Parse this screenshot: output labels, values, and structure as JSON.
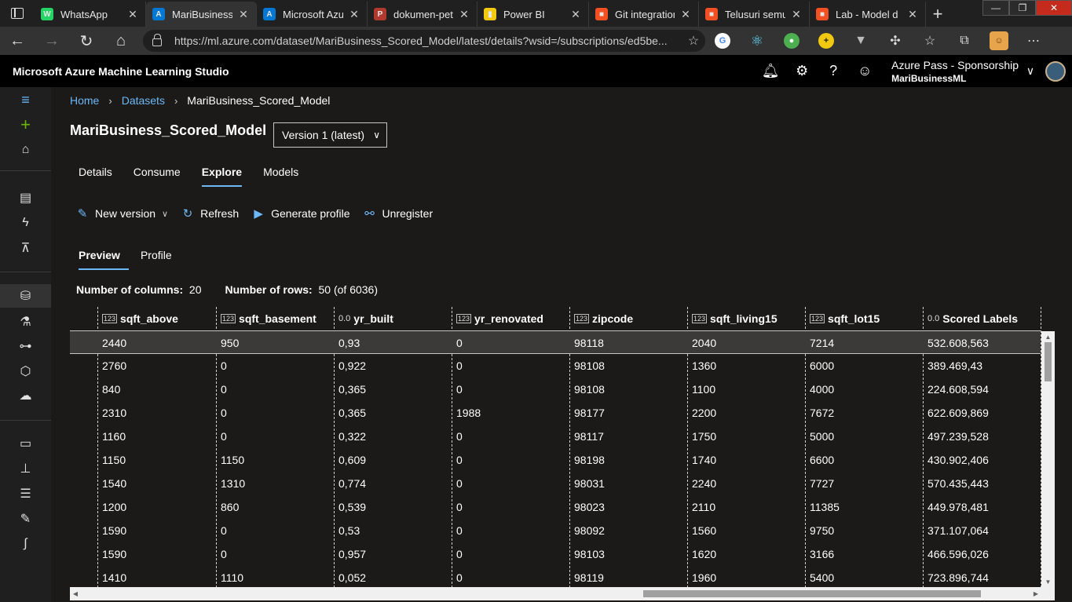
{
  "browser": {
    "tabs": [
      {
        "title": "WhatsApp",
        "fav_color": "#25d366",
        "fav_glyph": "W"
      },
      {
        "title": "MariBusiness_S",
        "fav_color": "#0078d4",
        "fav_glyph": "A"
      },
      {
        "title": "Microsoft Azu",
        "fav_color": "#0078d4",
        "fav_glyph": "A"
      },
      {
        "title": "dokumen-pet",
        "fav_color": "#b03a2e",
        "fav_glyph": "P"
      },
      {
        "title": "Power BI",
        "fav_color": "#f2c811",
        "fav_glyph": "▮"
      },
      {
        "title": "Git integration",
        "fav_color": "#f25022",
        "fav_glyph": "■"
      },
      {
        "title": "Telusuri semua",
        "fav_color": "#f25022",
        "fav_glyph": "■"
      },
      {
        "title": "Lab - Model d",
        "fav_color": "#f25022",
        "fav_glyph": "■"
      }
    ],
    "url": "https://ml.azure.com/dataset/MariBusiness_Scored_Model/latest/details?wsid=/subscriptions/ed5be..."
  },
  "app": {
    "brand": "Microsoft Azure Machine Learning Studio",
    "subscription": "Azure Pass - Sponsorship",
    "workspace": "MariBusinessML"
  },
  "breadcrumb": {
    "home": "Home",
    "datasets": "Datasets",
    "current": "MariBusiness_Scored_Model"
  },
  "page": {
    "title": "MariBusiness_Scored_Model",
    "version": "Version 1 (latest)"
  },
  "tabs": {
    "details": "Details",
    "consume": "Consume",
    "explore": "Explore",
    "models": "Models"
  },
  "toolbar": {
    "new_version": "New version",
    "refresh": "Refresh",
    "generate_profile": "Generate profile",
    "unregister": "Unregister"
  },
  "subtabs": {
    "preview": "Preview",
    "profile": "Profile"
  },
  "counts": {
    "columns_label": "Number of columns:",
    "columns_value": "20",
    "rows_label": "Number of rows:",
    "rows_value": "50 (of 6036)"
  },
  "grid": {
    "columns": [
      {
        "name": "sqft_above",
        "type": "123"
      },
      {
        "name": "sqft_basement",
        "type": "123"
      },
      {
        "name": "yr_built",
        "type": "0.0"
      },
      {
        "name": "yr_renovated",
        "type": "123"
      },
      {
        "name": "zipcode",
        "type": "123"
      },
      {
        "name": "sqft_living15",
        "type": "123"
      },
      {
        "name": "sqft_lot15",
        "type": "123"
      },
      {
        "name": "Scored Labels",
        "type": "0.0"
      }
    ],
    "rows": [
      [
        "2440",
        "950",
        "0,93",
        "0",
        "98118",
        "2040",
        "7214",
        "532.608,563"
      ],
      [
        "2760",
        "0",
        "0,922",
        "0",
        "98108",
        "1360",
        "6000",
        "389.469,43"
      ],
      [
        "840",
        "0",
        "0,365",
        "0",
        "98108",
        "1100",
        "4000",
        "224.608,594"
      ],
      [
        "2310",
        "0",
        "0,365",
        "1988",
        "98177",
        "2200",
        "7672",
        "622.609,869"
      ],
      [
        "1160",
        "0",
        "0,322",
        "0",
        "98117",
        "1750",
        "5000",
        "497.239,528"
      ],
      [
        "1150",
        "1150",
        "0,609",
        "0",
        "98198",
        "1740",
        "6600",
        "430.902,406"
      ],
      [
        "1540",
        "1310",
        "0,774",
        "0",
        "98031",
        "2240",
        "7727",
        "570.435,443"
      ],
      [
        "1200",
        "860",
        "0,539",
        "0",
        "98023",
        "2110",
        "11385",
        "449.978,481"
      ],
      [
        "1590",
        "0",
        "0,53",
        "0",
        "98092",
        "1560",
        "9750",
        "371.107,064"
      ],
      [
        "1590",
        "0",
        "0,957",
        "0",
        "98103",
        "1620",
        "3166",
        "466.596,026"
      ],
      [
        "1410",
        "1110",
        "0,052",
        "0",
        "98119",
        "1960",
        "5400",
        "723.896,744"
      ]
    ]
  }
}
